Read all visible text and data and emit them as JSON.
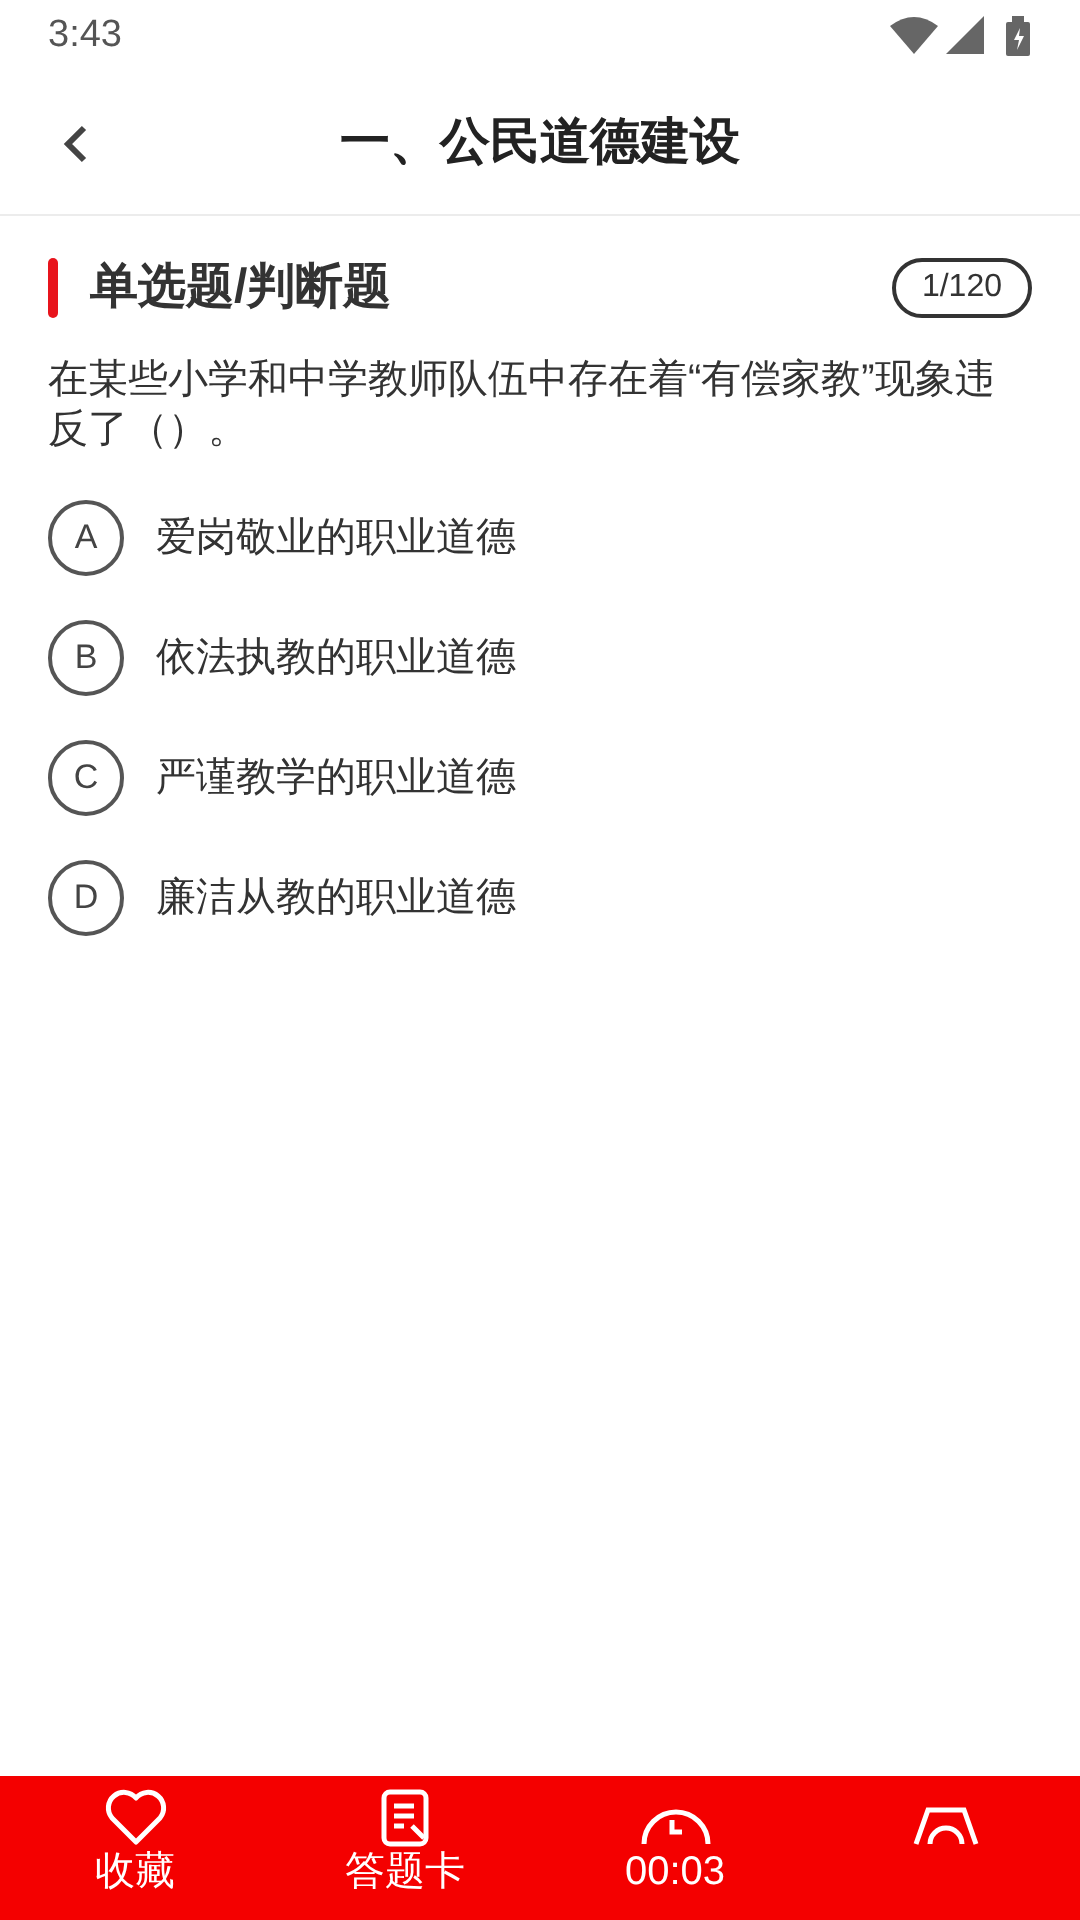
{
  "status_bar": {
    "time": "3:43"
  },
  "header": {
    "title": "一、公民道德建设"
  },
  "section": {
    "title": "单选题/判断题",
    "counter": "1/120"
  },
  "question": {
    "text": "在某些小学和中学教师队伍中存在着“有偿家教”现象违反了（）。"
  },
  "options": [
    {
      "letter": "A",
      "text": "爱岗敬业的职业道德",
      "selected": false
    },
    {
      "letter": "B",
      "text": "依法执教的职业道德",
      "selected": false
    },
    {
      "letter": "C",
      "text": "严谨教学的职业道德",
      "selected": false
    },
    {
      "letter": "D",
      "text": "廉洁从教的职业道德",
      "selected": false
    }
  ],
  "bottom_bar": [
    {
      "kind": "favorite",
      "label": "收藏"
    },
    {
      "kind": "card",
      "label": "答题卡"
    },
    {
      "kind": "timer",
      "label": "00:03"
    },
    {
      "kind": "submit"
    }
  ]
}
